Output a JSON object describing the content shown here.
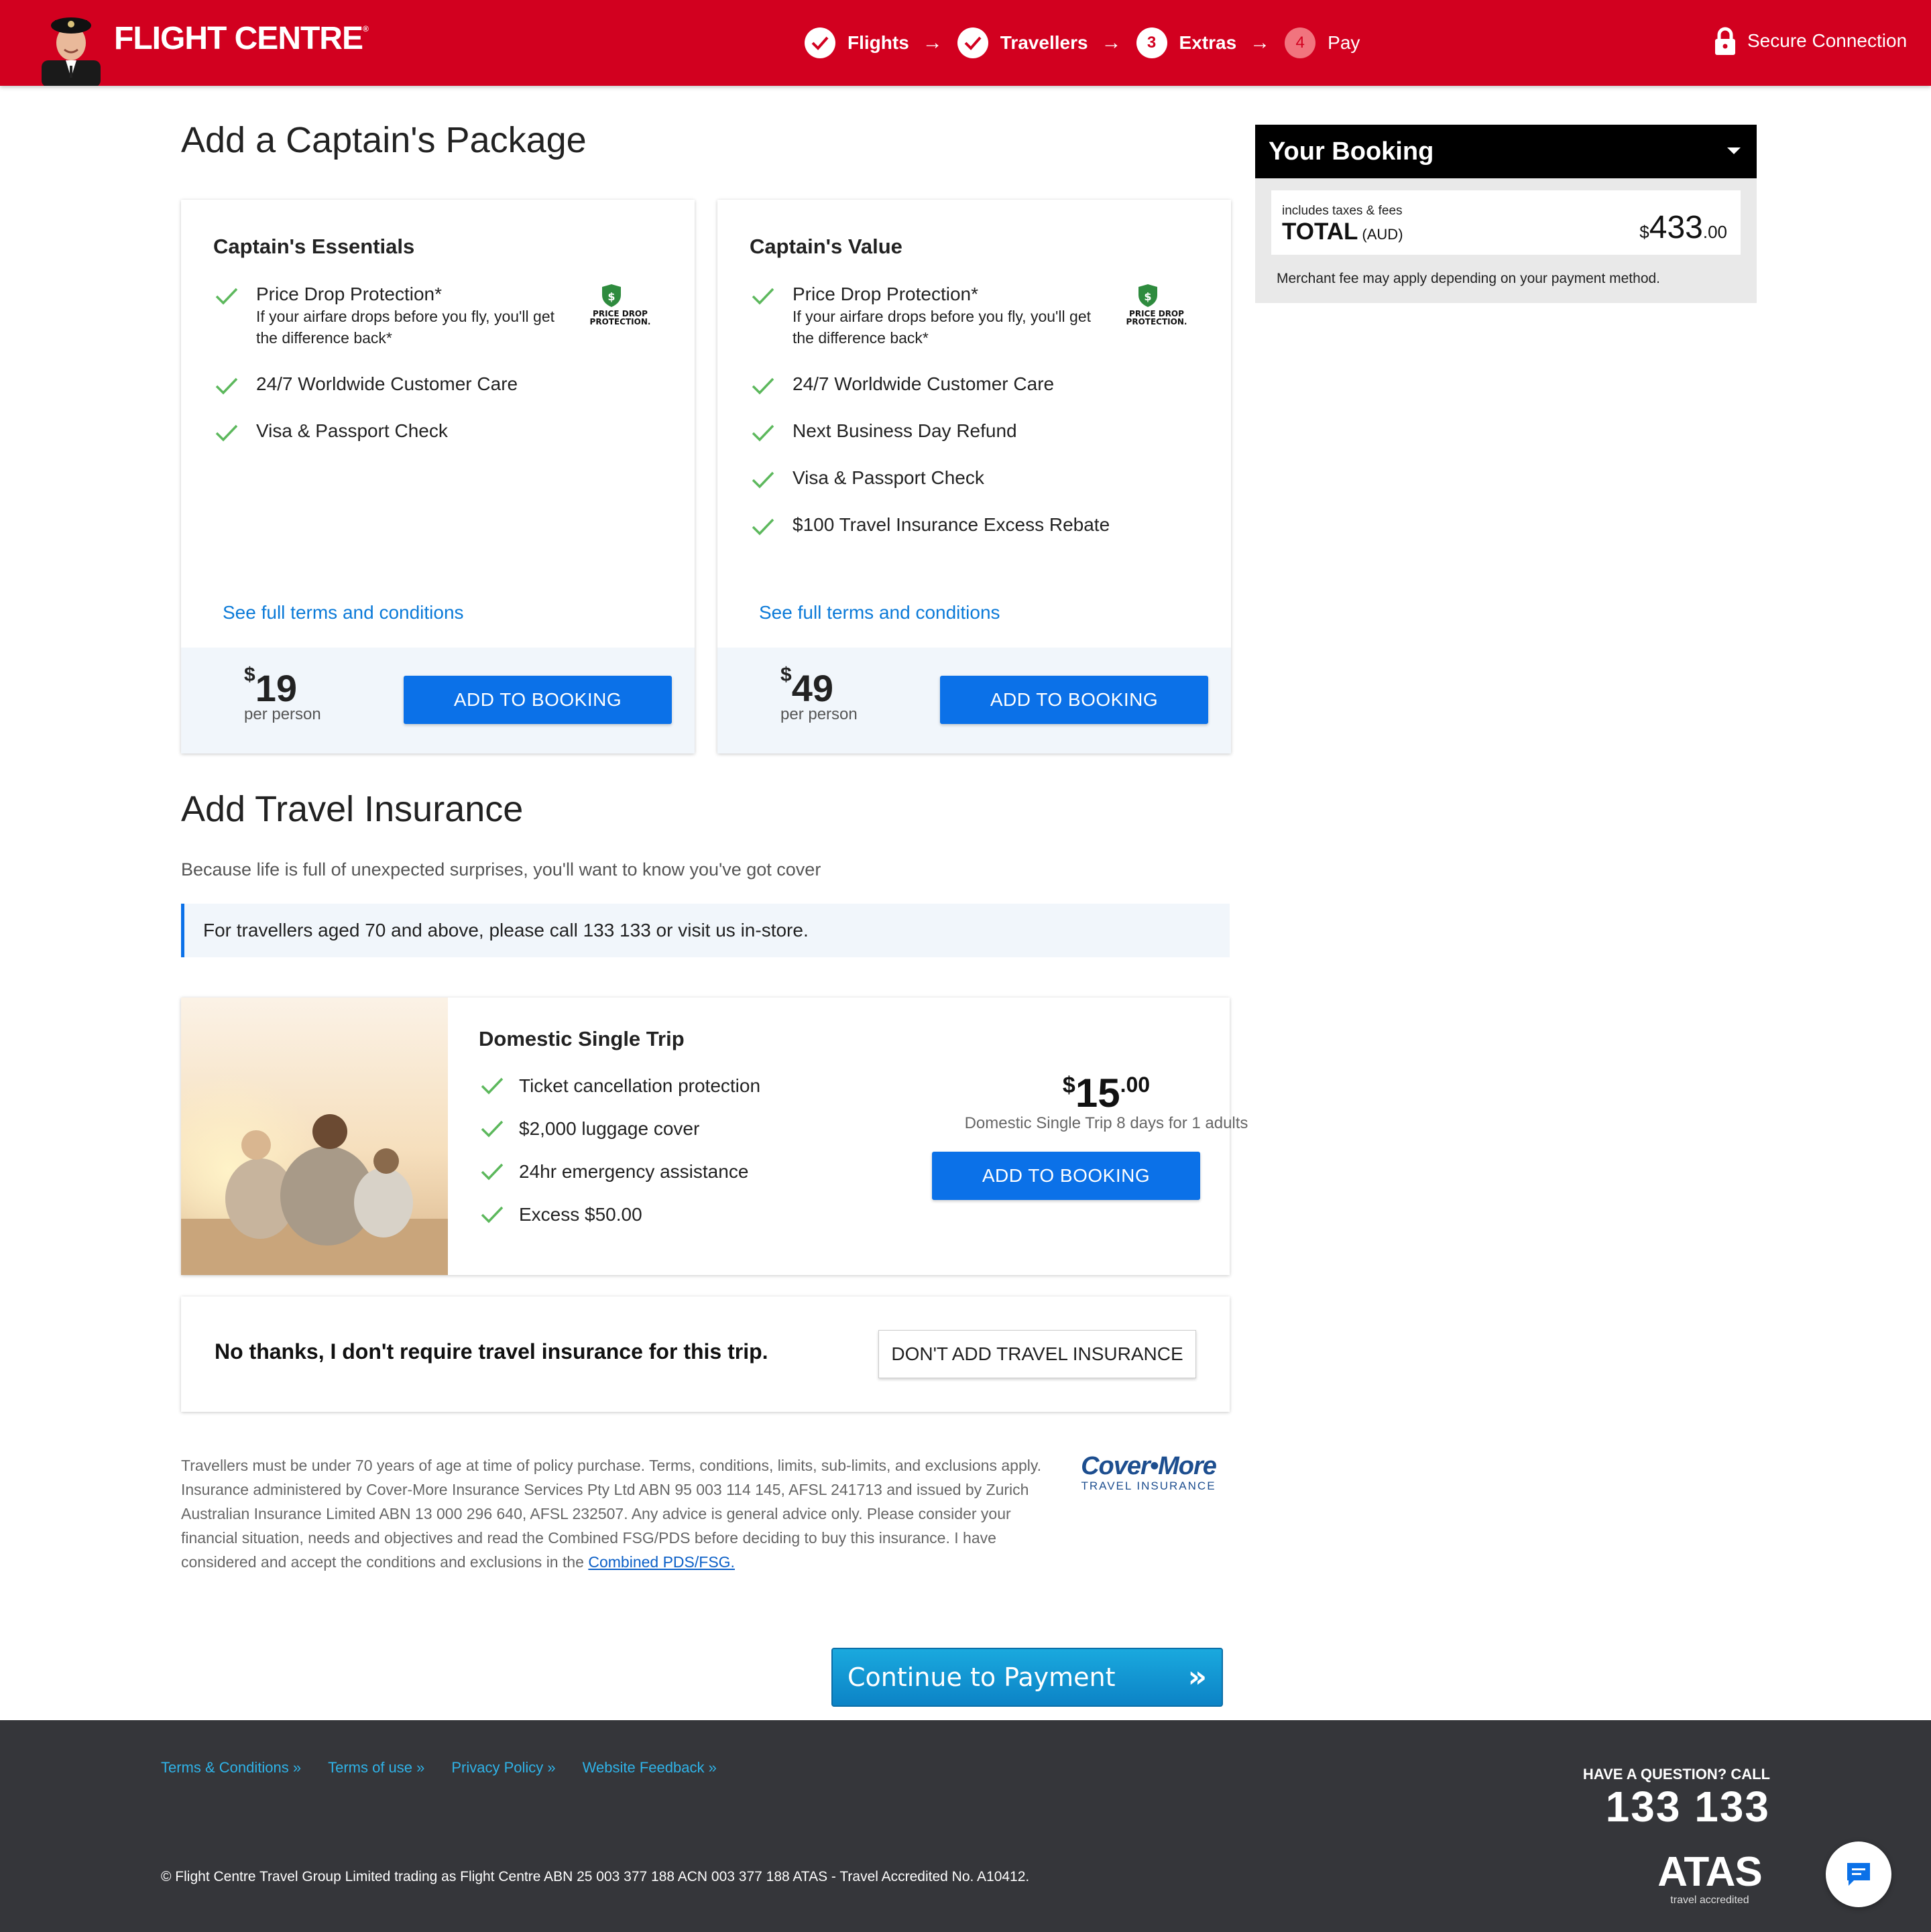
{
  "header": {
    "brand": "FLIGHT CENTRE",
    "steps": [
      {
        "label": "Flights",
        "state": "done"
      },
      {
        "label": "Travellers",
        "state": "done"
      },
      {
        "label": "Extras",
        "number": "3",
        "state": "current"
      },
      {
        "label": "Pay",
        "number": "4",
        "state": "pending"
      }
    ],
    "secure_label": "Secure Connection"
  },
  "packages": {
    "heading": "Add a Captain's Package",
    "essentials": {
      "title": "Captain's Essentials",
      "features": [
        {
          "title": "Price Drop Protection*",
          "desc": "If your airfare drops before you fly, you'll get the difference back*"
        },
        {
          "title": "24/7 Worldwide Customer Care"
        },
        {
          "title": "Visa & Passport Check"
        }
      ],
      "terms_link": "See full terms and conditions",
      "currency": "$",
      "price": "19",
      "price_unit": "per person",
      "button": "ADD TO BOOKING"
    },
    "value": {
      "title": "Captain's Value",
      "features": [
        {
          "title": "Price Drop Protection*",
          "desc": "If your airfare drops before you fly, you'll get the difference back*"
        },
        {
          "title": "24/7 Worldwide Customer Care"
        },
        {
          "title": "Next Business Day Refund"
        },
        {
          "title": "Visa & Passport Check"
        },
        {
          "title": "$100 Travel Insurance Excess Rebate"
        }
      ],
      "terms_link": "See full terms and conditions",
      "currency": "$",
      "price": "49",
      "price_unit": "per person",
      "button": "ADD TO BOOKING"
    },
    "badge_text": [
      "PRICE DROP",
      "PROTECTION."
    ]
  },
  "booking": {
    "title": "Your Booking",
    "taxes_note": "includes taxes & fees",
    "total_label": "TOTAL",
    "currency_code": "(AUD)",
    "currency": "$",
    "amount": "433",
    "cents": ".00",
    "merchant_note": "Merchant fee may apply depending on your payment method."
  },
  "insurance": {
    "heading": "Add Travel Insurance",
    "subheading": "Because life is full of unexpected surprises, you'll want to know you've got cover",
    "notice": "For travellers aged 70 and above, please call 133 133 or visit us in-store.",
    "plan": {
      "title": "Domestic Single Trip",
      "features": [
        "Ticket cancellation protection",
        "$2,000 luggage cover",
        "24hr emergency assistance",
        "Excess $50.00"
      ],
      "currency": "$",
      "price": "15",
      "cents": ".00",
      "desc": "Domestic Single Trip 8 days for 1 adults",
      "button": "ADD TO BOOKING"
    },
    "decline_text": "No thanks, I don't require travel insurance for this trip.",
    "decline_button": "DON'T ADD TRAVEL INSURANCE",
    "legal": "Travellers must be under 70 years of age at time of policy purchase. Terms, conditions, limits, sub-limits, and exclusions apply. Insurance administered by Cover-More Insurance Services Pty Ltd ABN 95 003 114 145, AFSL 241713 and issued by Zurich Australian Insurance Limited ABN 13 000 296 640, AFSL 232507. Any advice is general advice only. Please consider your financial situation, needs and objectives and read the Combined FSG/PDS before deciding to buy this insurance. I have considered and accept the conditions and exclusions in the",
    "legal_link": "Combined PDS/FSG.",
    "provider_name": "Cover•More",
    "provider_sub": "TRAVEL INSURANCE"
  },
  "continue_button": "Continue to Payment",
  "footer": {
    "links": [
      "Terms & Conditions »",
      "Terms of use »",
      "Privacy Policy »",
      "Website Feedback »"
    ],
    "copyright": "© Flight Centre Travel Group Limited trading as Flight Centre ABN 25 003 377 188 ACN 003 377 188 ATAS - Travel Accredited No. A10412.",
    "question": "HAVE A QUESTION? CALL",
    "phone": "133 133",
    "atas": "ATAS",
    "atas_sub": "travel accredited"
  },
  "colors": {
    "brand_red": "#d2001f",
    "primary_blue": "#0b71e8",
    "link_blue": "#0b7ad8",
    "check_green": "#5cb85c",
    "footer_bg": "#35363a"
  }
}
